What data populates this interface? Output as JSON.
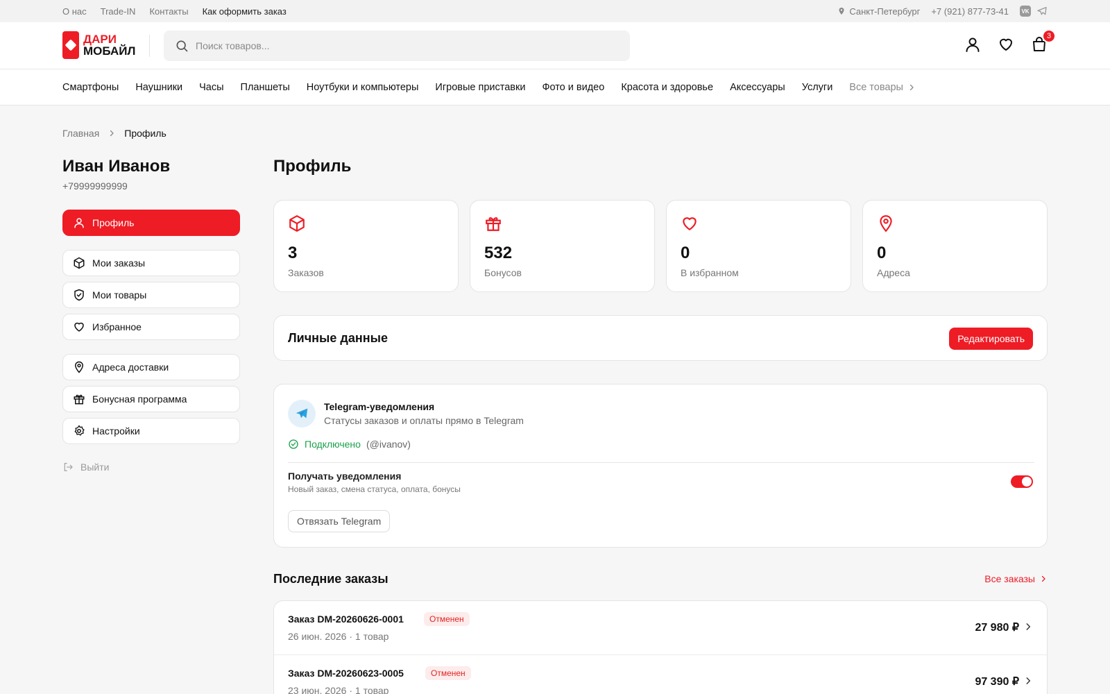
{
  "topbar": {
    "links": [
      "О нас",
      "Trade-IN",
      "Контакты",
      "Как оформить заказ"
    ],
    "city": "Санкт-Петербург",
    "phone": "+7 (921) 877-73-41",
    "vk_label": "VK"
  },
  "header": {
    "logo_line1": "ДАРИ",
    "logo_line2": "МОБАЙЛ",
    "search_placeholder": "Поиск товаров...",
    "cart_count": "3"
  },
  "nav": {
    "items": [
      "Смартфоны",
      "Наушники",
      "Часы",
      "Планшеты",
      "Ноутбуки и компьютеры",
      "Игровые приставки",
      "Фото и видео",
      "Красота и здоровье",
      "Аксессуары",
      "Услуги"
    ],
    "all": "Все товары"
  },
  "breadcrumb": {
    "home": "Главная",
    "current": "Профиль"
  },
  "user": {
    "name": "Иван Иванов",
    "phone": "+79999999999"
  },
  "sidebar": {
    "items": [
      {
        "label": "Профиль",
        "icon": "user-icon"
      },
      {
        "label": "Мои заказы",
        "icon": "box-icon"
      },
      {
        "label": "Мои товары",
        "icon": "shield-icon"
      },
      {
        "label": "Избранное",
        "icon": "heart-icon"
      },
      {
        "label": "Адреса доставки",
        "icon": "pin-icon"
      },
      {
        "label": "Бонусная программа",
        "icon": "gift-icon"
      },
      {
        "label": "Настройки",
        "icon": "gear-icon"
      }
    ],
    "logout": "Выйти"
  },
  "main": {
    "title": "Профиль",
    "stats": [
      {
        "value": "3",
        "label": "Заказов"
      },
      {
        "value": "532",
        "label": "Бонусов"
      },
      {
        "value": "0",
        "label": "В избранном"
      },
      {
        "value": "0",
        "label": "Адреса"
      }
    ],
    "personal_title": "Личные данные",
    "edit_label": "Редактировать",
    "telegram": {
      "title": "Telegram-уведомления",
      "subtitle": "Статусы заказов и оплаты прямо в Telegram",
      "status": "Подключено",
      "username": "(@ivanov)",
      "option_title": "Получать уведомления",
      "option_sub": "Новый заказ, смена статуса, оплата, бонусы",
      "notifications_on": true,
      "unlink_label": "Отвязать Telegram"
    },
    "orders_title": "Последние заказы",
    "all_orders": "Все заказы",
    "orders": [
      {
        "number": "Заказ DM-20260626-0001",
        "status": "Отменен",
        "date": "26 июн. 2026",
        "items": "1 товар",
        "price": "27 980 ₽"
      },
      {
        "number": "Заказ DM-20260623-0005",
        "status": "Отменен",
        "date": "23 июн. 2026",
        "items": "1 товар",
        "price": "97 390 ₽"
      }
    ]
  },
  "colors": {
    "accent": "#ee1c25",
    "success": "#1aa14b"
  }
}
